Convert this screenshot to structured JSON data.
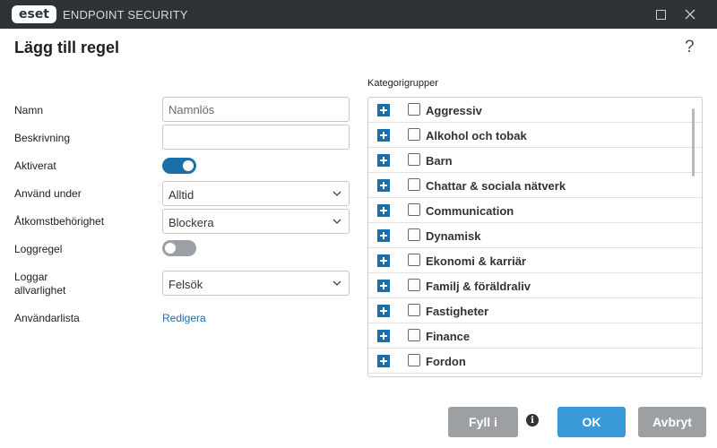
{
  "window": {
    "logo_text": "eset",
    "app_title": "ENDPOINT SECURITY"
  },
  "page": {
    "title": "Lägg till regel",
    "help_glyph": "?"
  },
  "form": {
    "name_label": "Namn",
    "name_placeholder": "Namnlös",
    "description_label": "Beskrivning",
    "description_value": "",
    "enabled_label": "Aktiverat",
    "enabled_state": true,
    "use_during_label": "Använd under",
    "use_during_value": "Alltid",
    "access_label": "Åtkomstbehörighet",
    "access_value": "Blockera",
    "log_rule_label": "Loggregel",
    "log_rule_state": false,
    "log_severity_label_line1": "Loggar",
    "log_severity_label_line2": "allvarlighet",
    "log_severity_value": "Felsök",
    "user_list_label": "Användarlista",
    "user_list_link": "Redigera"
  },
  "categories": {
    "label": "Kategorigrupper",
    "items": [
      {
        "label": "Aggressiv",
        "checked": false
      },
      {
        "label": "Alkohol och tobak",
        "checked": false
      },
      {
        "label": "Barn",
        "checked": false
      },
      {
        "label": "Chattar & sociala nätverk",
        "checked": false
      },
      {
        "label": "Communication",
        "checked": false
      },
      {
        "label": "Dynamisk",
        "checked": false
      },
      {
        "label": "Ekonomi & karriär",
        "checked": false
      },
      {
        "label": "Familj & föräldraliv",
        "checked": false
      },
      {
        "label": "Fastigheter",
        "checked": false
      },
      {
        "label": "Finance",
        "checked": false
      },
      {
        "label": "Fordon",
        "checked": false
      }
    ]
  },
  "buttons": {
    "fill": "Fyll i",
    "info_glyph": "i",
    "ok": "OK",
    "cancel": "Avbryt"
  },
  "colors": {
    "titlebar": "#2e3338",
    "accent": "#1b6fa8",
    "ok_button": "#3a9ad9",
    "grey_button": "#9da0a3"
  }
}
